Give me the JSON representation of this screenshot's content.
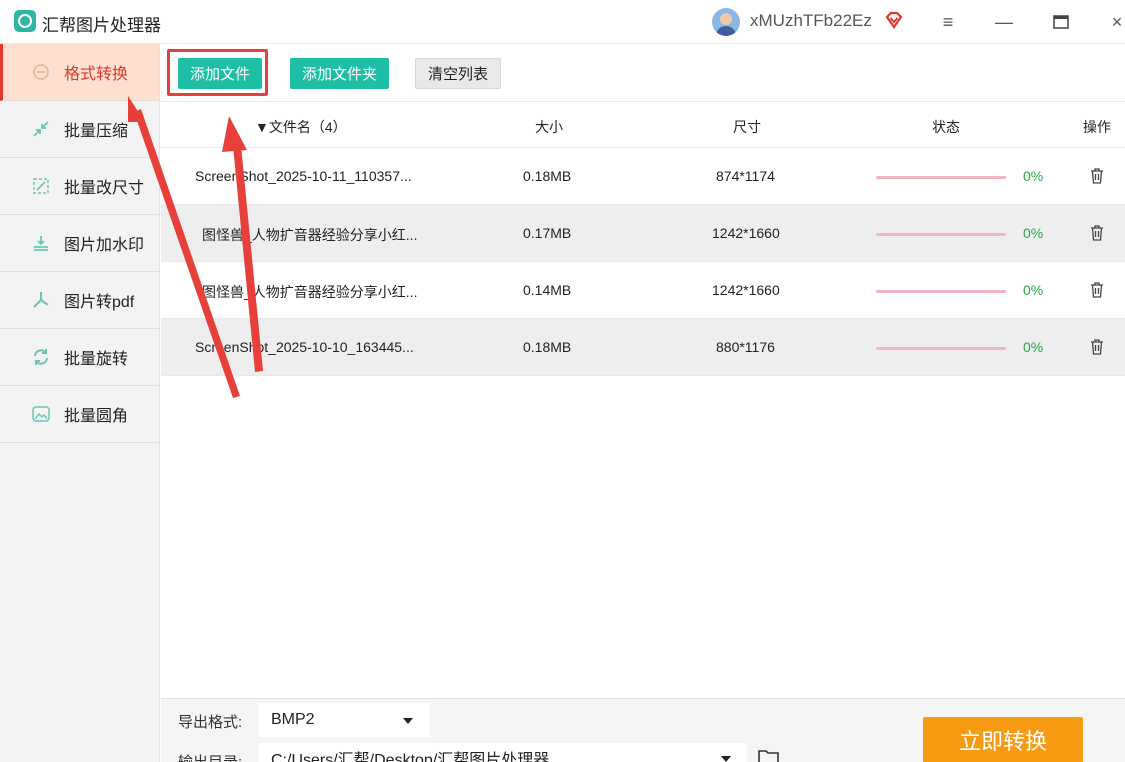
{
  "app": {
    "title": "汇帮图片处理器",
    "username": "xMUzhTFb22Ez"
  },
  "colors": {
    "accent": "#e0382b",
    "teal": "#1fbfa6",
    "orange": "#f79b12",
    "progress_green": "#27a844"
  },
  "window_controls": {
    "menu": "≡",
    "minimize": "—",
    "maximize": "☐",
    "close": "×"
  },
  "sidebar": {
    "items": [
      {
        "label": "格式转换",
        "icon": "format-convert-icon",
        "active": true
      },
      {
        "label": "批量压缩",
        "icon": "compress-icon"
      },
      {
        "label": "批量改尺寸",
        "icon": "resize-icon"
      },
      {
        "label": "图片加水印",
        "icon": "watermark-icon"
      },
      {
        "label": "图片转pdf",
        "icon": "pdf-icon"
      },
      {
        "label": "批量旋转",
        "icon": "rotate-icon"
      },
      {
        "label": "批量圆角",
        "icon": "round-corner-icon"
      }
    ]
  },
  "toolbar": {
    "add_file": "添加文件",
    "add_folder": "添加文件夹",
    "clear_list": "清空列表"
  },
  "table": {
    "headers": {
      "name": "▼文件名（4）",
      "size": "大小",
      "dimensions": "尺寸",
      "status": "状态",
      "action": "操作"
    },
    "rows": [
      {
        "name": "ScreenShot_2025-10-11_110357...",
        "size": "0.18MB",
        "dimensions": "874*1174",
        "progress": "0%"
      },
      {
        "name": "图怪兽_人物扩音器经验分享小红...",
        "size": "0.17MB",
        "dimensions": "1242*1660",
        "progress": "0%"
      },
      {
        "name": "图怪兽_人物扩音器经验分享小红...",
        "size": "0.14MB",
        "dimensions": "1242*1660",
        "progress": "0%"
      },
      {
        "name": "ScreenShot_2025-10-10_163445...",
        "size": "0.18MB",
        "dimensions": "880*1176",
        "progress": "0%"
      }
    ]
  },
  "bottom": {
    "format_label": "导出格式:",
    "format_value": "BMP2",
    "dir_label": "输出目录:",
    "dir_value": "C:/Users/汇帮/Desktop/汇帮图片处理器",
    "convert": "立即转换"
  }
}
